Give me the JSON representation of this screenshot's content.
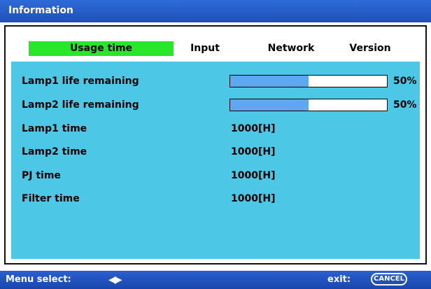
{
  "window": {
    "title": "Information"
  },
  "tabs": [
    {
      "label": "Usage time",
      "active": true
    },
    {
      "label": "Input",
      "active": false
    },
    {
      "label": "Network",
      "active": false
    },
    {
      "label": "Version",
      "active": false
    }
  ],
  "rows": {
    "lamp1_life": {
      "label": "Lamp1 life remaining",
      "percent_text": "50%",
      "fraction": 0.5
    },
    "lamp2_life": {
      "label": "Lamp2 life remaining",
      "percent_text": "50%",
      "fraction": 0.5
    },
    "lamp1_time": {
      "label": "Lamp1 time",
      "value": "1000[H]"
    },
    "lamp2_time": {
      "label": "Lamp2 time",
      "value": "1000[H]"
    },
    "pj_time": {
      "label": "PJ time",
      "value": "1000[H]"
    },
    "filter_time": {
      "label": "Filter time",
      "value": "1000[H]"
    }
  },
  "footer": {
    "menu_select_label": "Menu select:",
    "arrows_icon": "left-right-arrows-icon",
    "arrows_glyph": "◀▶",
    "exit_label": "exit:",
    "cancel_label": "CANCEL"
  },
  "colors": {
    "titlebar": "#2f6bd8",
    "active_tab": "#28e628",
    "content_bg": "#4cc7e6",
    "bar_fill": "#5da8f0"
  }
}
